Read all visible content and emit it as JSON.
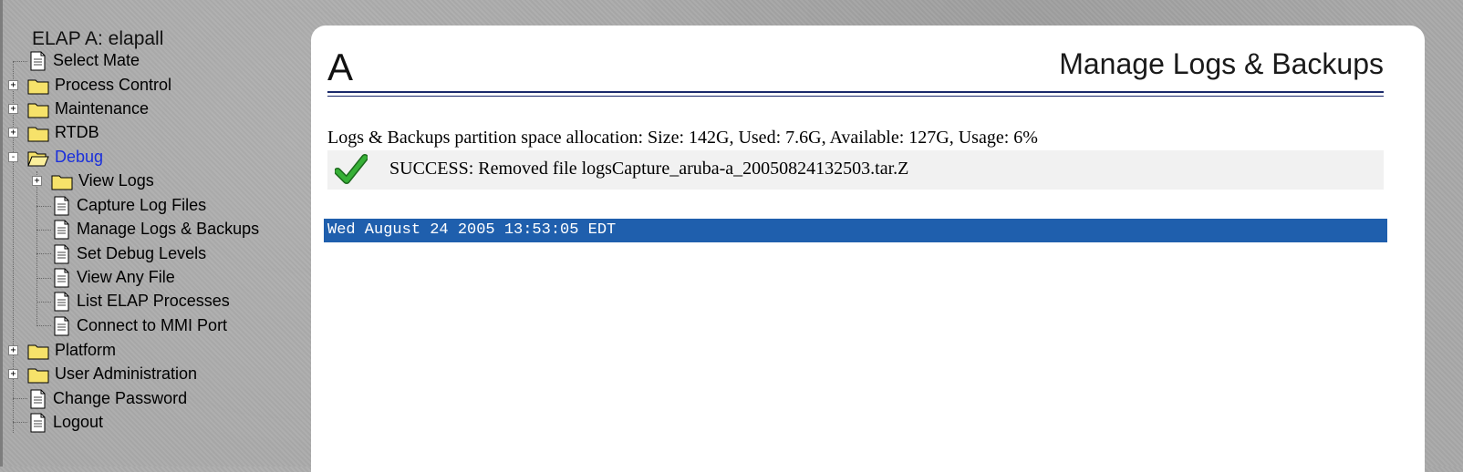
{
  "sidebar": {
    "host_title": "ELAP A: elapall",
    "items": [
      {
        "label": "Select Mate",
        "icon": "document-icon"
      },
      {
        "label": "Process Control",
        "icon": "folder-icon",
        "expander": "+"
      },
      {
        "label": "Maintenance",
        "icon": "folder-icon",
        "expander": "+"
      },
      {
        "label": "RTDB",
        "icon": "folder-icon",
        "expander": "+"
      },
      {
        "label": "Debug",
        "icon": "folder-open-icon",
        "expander": "-"
      },
      {
        "label": "View Logs",
        "icon": "folder-icon",
        "expander": "+"
      },
      {
        "label": "Capture Log Files",
        "icon": "document-icon"
      },
      {
        "label": "Manage Logs & Backups",
        "icon": "document-icon"
      },
      {
        "label": "Set Debug Levels",
        "icon": "document-icon"
      },
      {
        "label": "View Any File",
        "icon": "document-icon"
      },
      {
        "label": "List ELAP Processes",
        "icon": "document-icon"
      },
      {
        "label": "Connect to MMI Port",
        "icon": "document-icon"
      },
      {
        "label": "Platform",
        "icon": "folder-icon",
        "expander": "+"
      },
      {
        "label": "User Administration",
        "icon": "folder-icon",
        "expander": "+"
      },
      {
        "label": "Change Password",
        "icon": "document-icon"
      },
      {
        "label": "Logout",
        "icon": "document-icon"
      }
    ]
  },
  "main": {
    "side_letter": "A",
    "page_title": "Manage Logs & Backups",
    "allocation_text": "Logs & Backups partition space allocation: Size: 142G, Used: 7.6G, Available: 127G, Usage: 6%",
    "success_message": "SUCCESS: Removed file logsCapture_aruba-a_20050824132503.tar.Z",
    "success_icon": "checkmark-icon",
    "timestamp": "Wed August 24 2005 13:53:05 EDT"
  },
  "colors": {
    "active_link": "#1a2fdc",
    "timestamp_bar": "#1f5fad",
    "checkmark": "#2e9a2e",
    "rule": "#1b2a6b"
  }
}
